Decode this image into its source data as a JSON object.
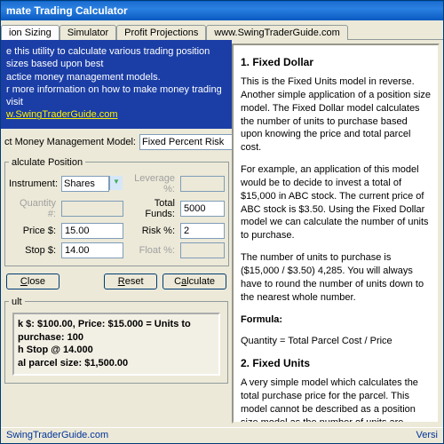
{
  "window": {
    "title": "mate Trading Calculator"
  },
  "tabs": [
    {
      "label": "ion Sizing",
      "active": true
    },
    {
      "label": "Simulator"
    },
    {
      "label": "Profit Projections"
    },
    {
      "label": "www.SwingTraderGuide.com"
    }
  ],
  "banner": {
    "line1": "e this utility to calculate various trading position sizes based upon best",
    "line2": "actice money management models.",
    "line3": "r more information on how to make money trading visit",
    "link": "w.SwingTraderGuide.com"
  },
  "model": {
    "label": "ct Money Management Model:",
    "value": "Fixed Percent Risk"
  },
  "calc": {
    "legend": "alculate Position",
    "labels": {
      "instrument": "Instrument:",
      "quantity": "Quantity #:",
      "price": "Price $:",
      "stop": "Stop $:",
      "leverage": "Leverage %:",
      "totalfunds": "Total Funds:",
      "risk": "Risk %:",
      "float": "Float %:"
    },
    "values": {
      "instrument": "Shares",
      "quantity": "",
      "price": "15.00",
      "stop": "14.00",
      "leverage": "",
      "totalfunds": "5000",
      "risk": "2",
      "float": ""
    }
  },
  "buttons": {
    "close": "Close",
    "reset": "Reset",
    "calculate": "Calculate"
  },
  "result": {
    "legend": "ult",
    "line1": "k $: $100.00, Price: $15.000 = Units to purchase: 100",
    "line2": "h Stop @ 14.000",
    "line3": "al parcel size: $1,500.00"
  },
  "help": {
    "h1": "1. Fixed Dollar",
    "p1": "This is the Fixed Units model in reverse. Another simple application of a position size model. The Fixed Dollar model calculates the number of units to purchase based upon knowing the price and total parcel cost.",
    "p2": "For example, an application of this model would be to decide to invest a total of $15,000 in ABC stock. The current price of ABC stock is $3.50. Using the Fixed Dollar model we can calculate the number of units to purchase.",
    "p3": "The number of units to purchase is ($15,000 / $3.50) 4,285. You will always have to round the number of units down to the nearest whole number.",
    "formula_h": "Formula:",
    "formula": "Quantity = Total Parcel Cost / Price",
    "h2": "2. Fixed Units",
    "p4": "A very simple model which calculates the total purchase price for the parcel. This model cannot be described as a position size model as the number of units are"
  },
  "status": {
    "left": "SwingTraderGuide.com",
    "right": "Versi"
  }
}
